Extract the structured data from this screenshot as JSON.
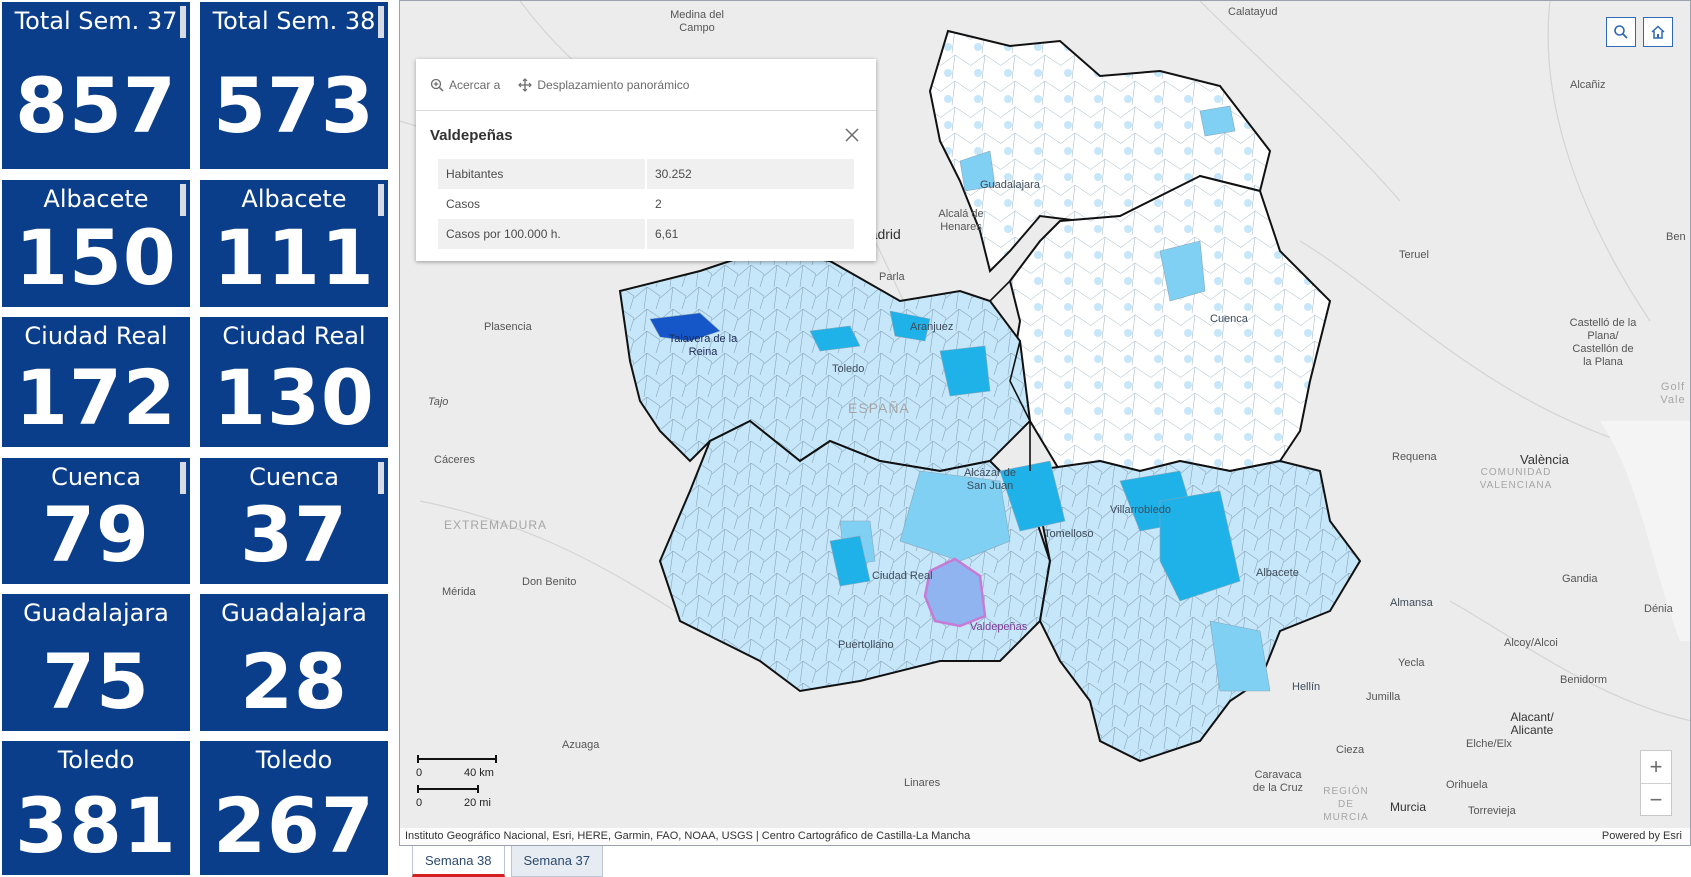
{
  "indicators": [
    {
      "title": "Total Sem. 37",
      "value": "857"
    },
    {
      "title": "Total Sem. 38",
      "value": "573"
    },
    {
      "title": "Albacete",
      "value": "150"
    },
    {
      "title": "Albacete",
      "value": "111"
    },
    {
      "title": "Ciudad Real",
      "value": "172"
    },
    {
      "title": "Ciudad Real",
      "value": "130"
    },
    {
      "title": "Cuenca",
      "value": "79"
    },
    {
      "title": "Cuenca",
      "value": "37"
    },
    {
      "title": "Guadalajara",
      "value": "75"
    },
    {
      "title": "Guadalajara",
      "value": "28"
    },
    {
      "title": "Toledo",
      "value": "381"
    },
    {
      "title": "Toledo",
      "value": "267"
    }
  ],
  "colors": {
    "tile_bg": "#0a3d8a",
    "map_bg": "#ececec",
    "municipality_light": "#c6e6f9",
    "municipality_mid": "#7fd0f2",
    "municipality_high": "#1fb2e8",
    "municipality_top": "#1556c9",
    "selected_fill": "#8fb4f0",
    "selected_outline": "#c77ad6",
    "tab_active_underline": "#d42020"
  },
  "map": {
    "places": {
      "medina": "Medina del Campo",
      "calatayud": "Calatayud",
      "alcaniz": "Alcañiz",
      "madrid": "Madrid",
      "alcala": "Alcalá de Henares",
      "guadalajara": "Guadalajara",
      "parla": "Parla",
      "plasencia": "Plasencia",
      "aranjuez": "Aranjuez",
      "talavera": "Talavera de la Reina",
      "toledo": "Toledo",
      "espana": "ESPAÑA",
      "tajo": "Tajo",
      "caceres": "Cáceres",
      "extremadura": "EXTREMADURA",
      "merida": "Mérida",
      "donbenito": "Don Benito",
      "alcazar": "Alcázar de San Juan",
      "tomelloso": "Tomelloso",
      "villarrobledo": "Villarrobledo",
      "ciudadreal": "Ciudad Real",
      "valdepenas": "Valdepeñas",
      "puertollano": "Puertollano",
      "cuenca": "Cuenca",
      "teruel": "Teruel",
      "castello": "Castelló de la Plana/ Castellón de la Plana",
      "requena": "Requena",
      "valencia": "València",
      "comunidad": "COMUNIDAD VALENCIANA",
      "albacete": "Albacete",
      "almansa": "Almansa",
      "gandia": "Gandia",
      "denia": "Dénia",
      "alcoy": "Alcoy/Alcoi",
      "benidorm": "Benidorm",
      "yecla": "Yecla",
      "hellin": "Hellín",
      "jumilla": "Jumilla",
      "azuaga": "Azuaga",
      "linares": "Linares",
      "cieza": "Cieza",
      "caravaca": "Caravaca de la Cruz",
      "murcia_region": "REGIÓN DE MURCIA",
      "murcia": "Murcia",
      "orihuela": "Orihuela",
      "torrevieja": "Torrevieja",
      "alicante": "Alacant/ Alicante",
      "elche": "Elche/Elx",
      "ben": "Ben",
      "golf": "Golf Vale"
    },
    "search_icon": "search-icon",
    "home_icon": "home-icon",
    "zoom_in_label": "+",
    "zoom_out_label": "−",
    "scale_km": "40 km",
    "scale_mi": "20 mi",
    "scale_zero_km": "0",
    "scale_zero_mi": "0",
    "attribution": "Instituto Geográfico Nacional, Esri, HERE, Garmin, FAO, NOAA, USGS | Centro Cartográfico de Castilla-La Mancha",
    "powered_by": "Powered by Esri"
  },
  "popup": {
    "action_zoom": "Acercar a",
    "action_pan": "Desplazamiento panorámico",
    "title": "Valdepeñas",
    "rows": [
      {
        "key": "Habitantes",
        "value": "30.252"
      },
      {
        "key": "Casos",
        "value": "2"
      },
      {
        "key": "Casos por 100.000 h.",
        "value": "6,61"
      }
    ]
  },
  "tabs": [
    {
      "label": "Semana 38",
      "active": true
    },
    {
      "label": "Semana 37",
      "active": false
    }
  ]
}
